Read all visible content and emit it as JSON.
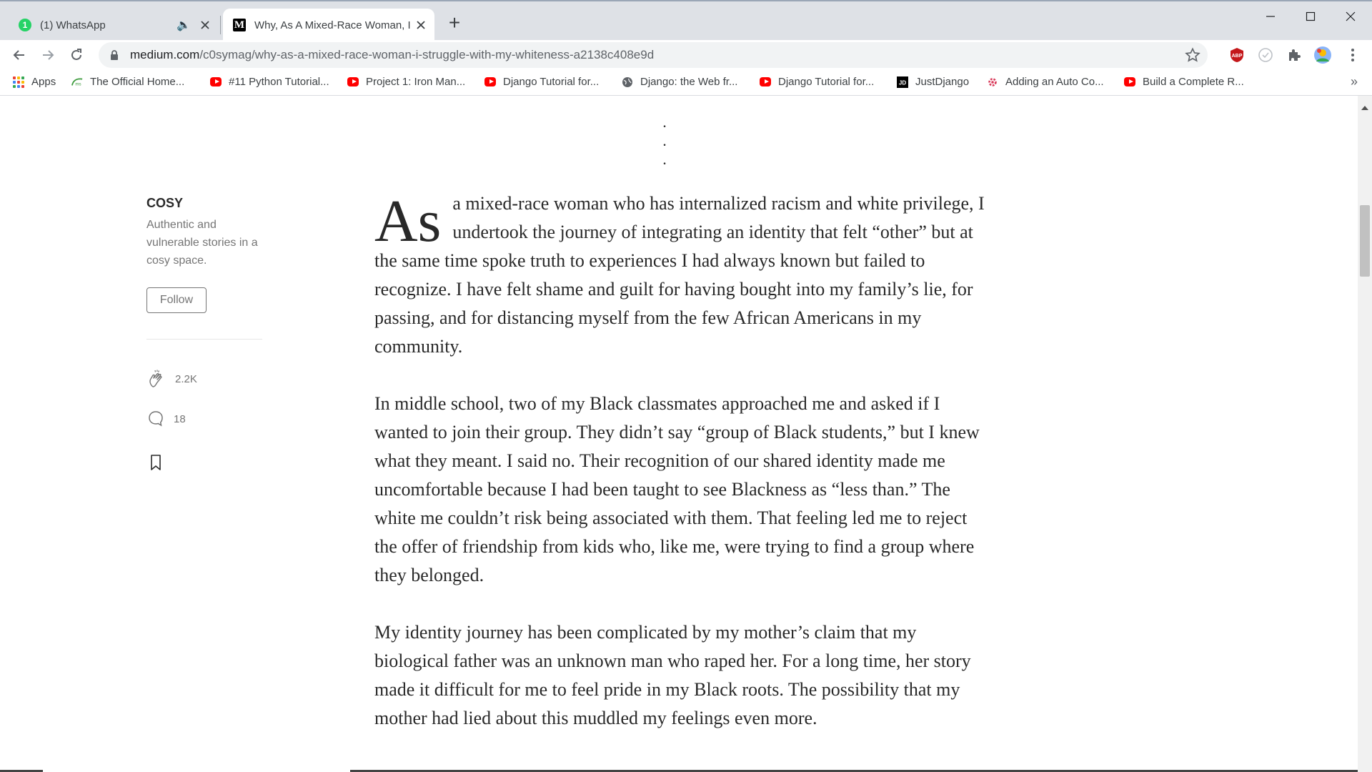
{
  "tabs": [
    {
      "title": "(1) WhatsApp",
      "badge": "1",
      "audio": "🔈"
    },
    {
      "title": "Why, As A Mixed-Race Woman, I",
      "favicon": "M"
    }
  ],
  "new_tab": "+",
  "window": {
    "minimize": "─",
    "maximize": "□",
    "close": "✕"
  },
  "toolbar": {
    "url_host": "medium.com",
    "url_path": "/c0symag/why-as-a-mixed-race-woman-i-struggle-with-my-whiteness-a2138c408e9d",
    "icons": [
      "back-icon",
      "forward-icon",
      "reload-icon",
      "lock-icon",
      "star-icon",
      "adblock-icon",
      "sync-icon",
      "extensions-icon",
      "profile-avatar",
      "more-menu-icon"
    ]
  },
  "bookmarks": [
    {
      "label": "Apps"
    },
    {
      "label": "The Official Home..."
    },
    {
      "label": "#11 Python Tutorial..."
    },
    {
      "label": "Project 1: Iron Man..."
    },
    {
      "label": "Django Tutorial for..."
    },
    {
      "label": "Django: the Web fr..."
    },
    {
      "label": "Django Tutorial for..."
    },
    {
      "label": "JustDjango"
    },
    {
      "label": "Adding an Auto Co..."
    },
    {
      "label": "Build a Complete R..."
    }
  ],
  "bookmarks_more": "»",
  "separator_dots": "· · ·",
  "publication": {
    "name": "COSY",
    "description": "Authentic and vulnerable stories in a cosy space.",
    "follow_label": "Follow"
  },
  "actions": {
    "claps": "2.2K",
    "responses": "18"
  },
  "article": {
    "dropcap": "As",
    "paragraph1_rest": " a mixed-race woman who has internalized racism and white privilege, I undertook the journey of integrating an identity that felt “other” but at the same time spoke truth to experiences I had always known but failed to recognize. I have felt shame and guilt for having bought into my family’s lie, for passing, and for distancing myself from the few African Americans in my community.",
    "paragraph2": "In middle school, two of my Black classmates approached me and asked if I wanted to join their group. They didn’t say “group of Black students,” but I knew what they meant. I said no. Their recognition of our shared identity made me uncomfortable because I had been taught to see Blackness as “less than.” The white me couldn’t risk being associated with them. That feeling led me to reject the offer of friendship from kids who, like me, were trying to find a group where they belonged.",
    "paragraph3": "My identity journey has been complicated by my mother’s claim that my biological father was an unknown man who raped her. For a long time, her story made it difficult for me to feel pride in my Black roots. The possibility that my mother had lied about this muddled my feelings even more."
  },
  "colors": {
    "accent_text": "#292929",
    "muted": "#757575",
    "chrome_bg": "#dee1e6"
  }
}
